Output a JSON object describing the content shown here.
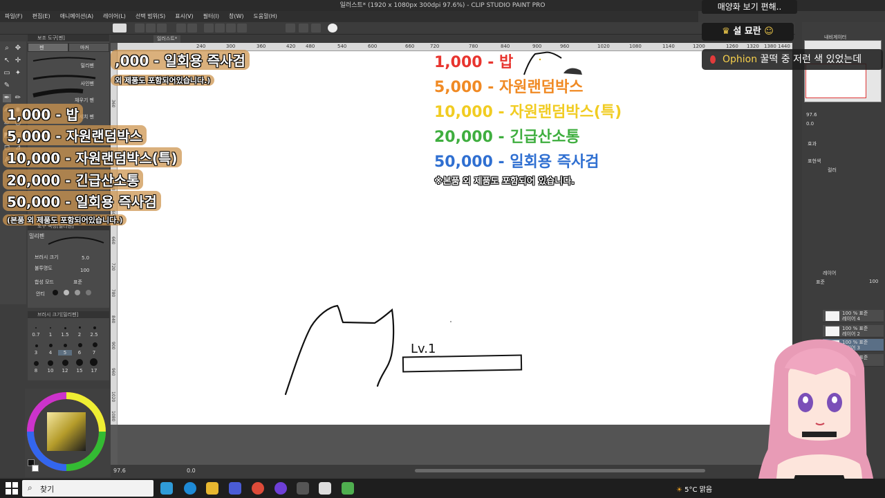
{
  "window": {
    "title": "일러스트* (1920 x 1080px 300dpi 97.6%) - CLIP STUDIO PAINT PRO"
  },
  "menu": [
    "파일(F)",
    "편집(E)",
    "애니메이션(A)",
    "레이어(L)",
    "선택 범위(S)",
    "표시(V)",
    "필터(I)",
    "창(W)",
    "도움말(H)"
  ],
  "doc_tabs": [
    "일러스트*"
  ],
  "tool_panel": {
    "title": "보조 도구[펜]",
    "tabs": [
      "펜",
      "마커"
    ],
    "brushes": [
      "밀리펜",
      "사인펜",
      "채우기 펜",
      "세치 펜"
    ]
  },
  "tool_props": {
    "title": "도구 속성[밀리펜]",
    "brush_name": "밀리펜",
    "brush_size_label": "브러시 크기",
    "brush_size_value": "5.0",
    "opacity_label": "불투명도",
    "opacity_value": "100",
    "blend_label": "합성 모드",
    "blend_value": "표준",
    "aa_label": "안티"
  },
  "brush_size_panel": {
    "title": "브러시 크기[밀리펜]",
    "sizes": [
      "0.7",
      "1",
      "1.5",
      "2",
      "2.5",
      "3",
      "4",
      "5",
      "6",
      "7",
      "8",
      "10",
      "12",
      "15",
      "17"
    ]
  },
  "ruler": {
    "top_ticks": [
      "240",
      "300",
      "360",
      "420",
      "480",
      "540",
      "600",
      "660",
      "720",
      "780",
      "840",
      "900",
      "960",
      "1020",
      "1080",
      "1140",
      "1200",
      "1260",
      "1320",
      "1380",
      "1440"
    ],
    "left_ticks": [
      "360",
      "420",
      "480",
      "540",
      "600",
      "660",
      "720",
      "780",
      "840",
      "900",
      "960",
      "1020",
      "1080"
    ]
  },
  "canvas": {
    "level_text": "Lv.1"
  },
  "donations_left": {
    "top_partial": ",000 - 일회용 즉사검",
    "top_note": "외 제품도 포함되어있습니다.)",
    "items": [
      "1,000 - 밥",
      "5,000 - 자원랜덤박스",
      "10,000 - 자원랜덤박스(특)",
      "20,000 - 긴급산소통",
      "50,000 - 일회용 즉사검"
    ],
    "note": "(본품 외 제품도 포함되어있습니다.)"
  },
  "donations_right": {
    "items": [
      {
        "text": "1,000 - 밥",
        "color": "#e8352f"
      },
      {
        "text": "5,000 - 자원랜덤박스",
        "color": "#f08a24"
      },
      {
        "text": "10,000 - 자원랜덤박스(특)",
        "color": "#f1cc22"
      },
      {
        "text": "20,000 - 긴급산소통",
        "color": "#3fae3f"
      },
      {
        "text": "50,000 - 일회용 즉사검",
        "color": "#2f6fd1"
      }
    ],
    "note": "※본품 외 제품도 포함되어 있습니다."
  },
  "status": {
    "zoom": "97.6",
    "angle": "0.0"
  },
  "right_panel": {
    "navigator_title": "내비게이터",
    "nav_zoom": "97.6",
    "nav_angle": "0.0",
    "effect_label": "효과",
    "express_label": "표현색",
    "express_value": "컬러",
    "layer_panel_title": "레이어",
    "blend_mode": "표준",
    "opacity": "100",
    "layers": [
      {
        "line1": "100 % 표준",
        "line2": "레이어 4"
      },
      {
        "line1": "100 % 표준",
        "line2": "레이어 2"
      },
      {
        "line1": "100 % 표준",
        "line2": "레이어 3"
      },
      {
        "line1": "100 % 표준",
        "line2": "종이"
      }
    ]
  },
  "stream": {
    "banner": "매양화 보기 편해..",
    "streamer_name": "설 묘란",
    "chat_user": "Ophion",
    "chat_message": " 꿀떡 중 저런 색 있었는데"
  },
  "taskbar": {
    "search_placeholder": "찾기",
    "weather": "5°C 맑음"
  },
  "colors": {
    "accent_gold": "#f7d04c",
    "chat_bg": "#1e1e1e",
    "left_pill": "#cd9650"
  }
}
